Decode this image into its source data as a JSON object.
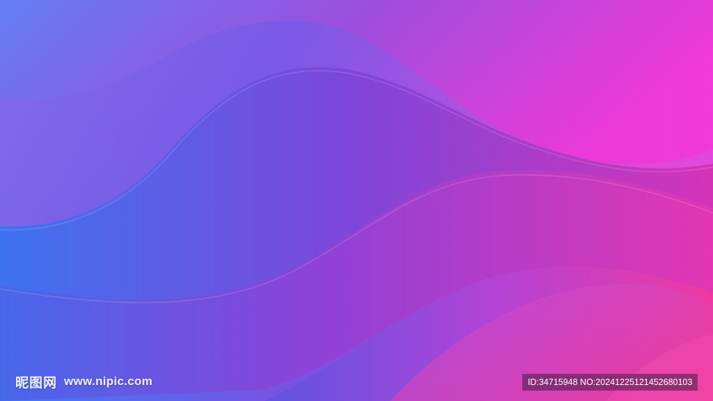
{
  "image": {
    "description_colors": {
      "blue": "#3d6ef5",
      "violet": "#8a4fe0",
      "magenta": "#e43cd8",
      "pink": "#f0388a"
    }
  },
  "watermark": {
    "logo_cn": "昵图网",
    "url": "www.nipic.com",
    "id_text": "ID:34715948 NO:20241225121452680103"
  }
}
